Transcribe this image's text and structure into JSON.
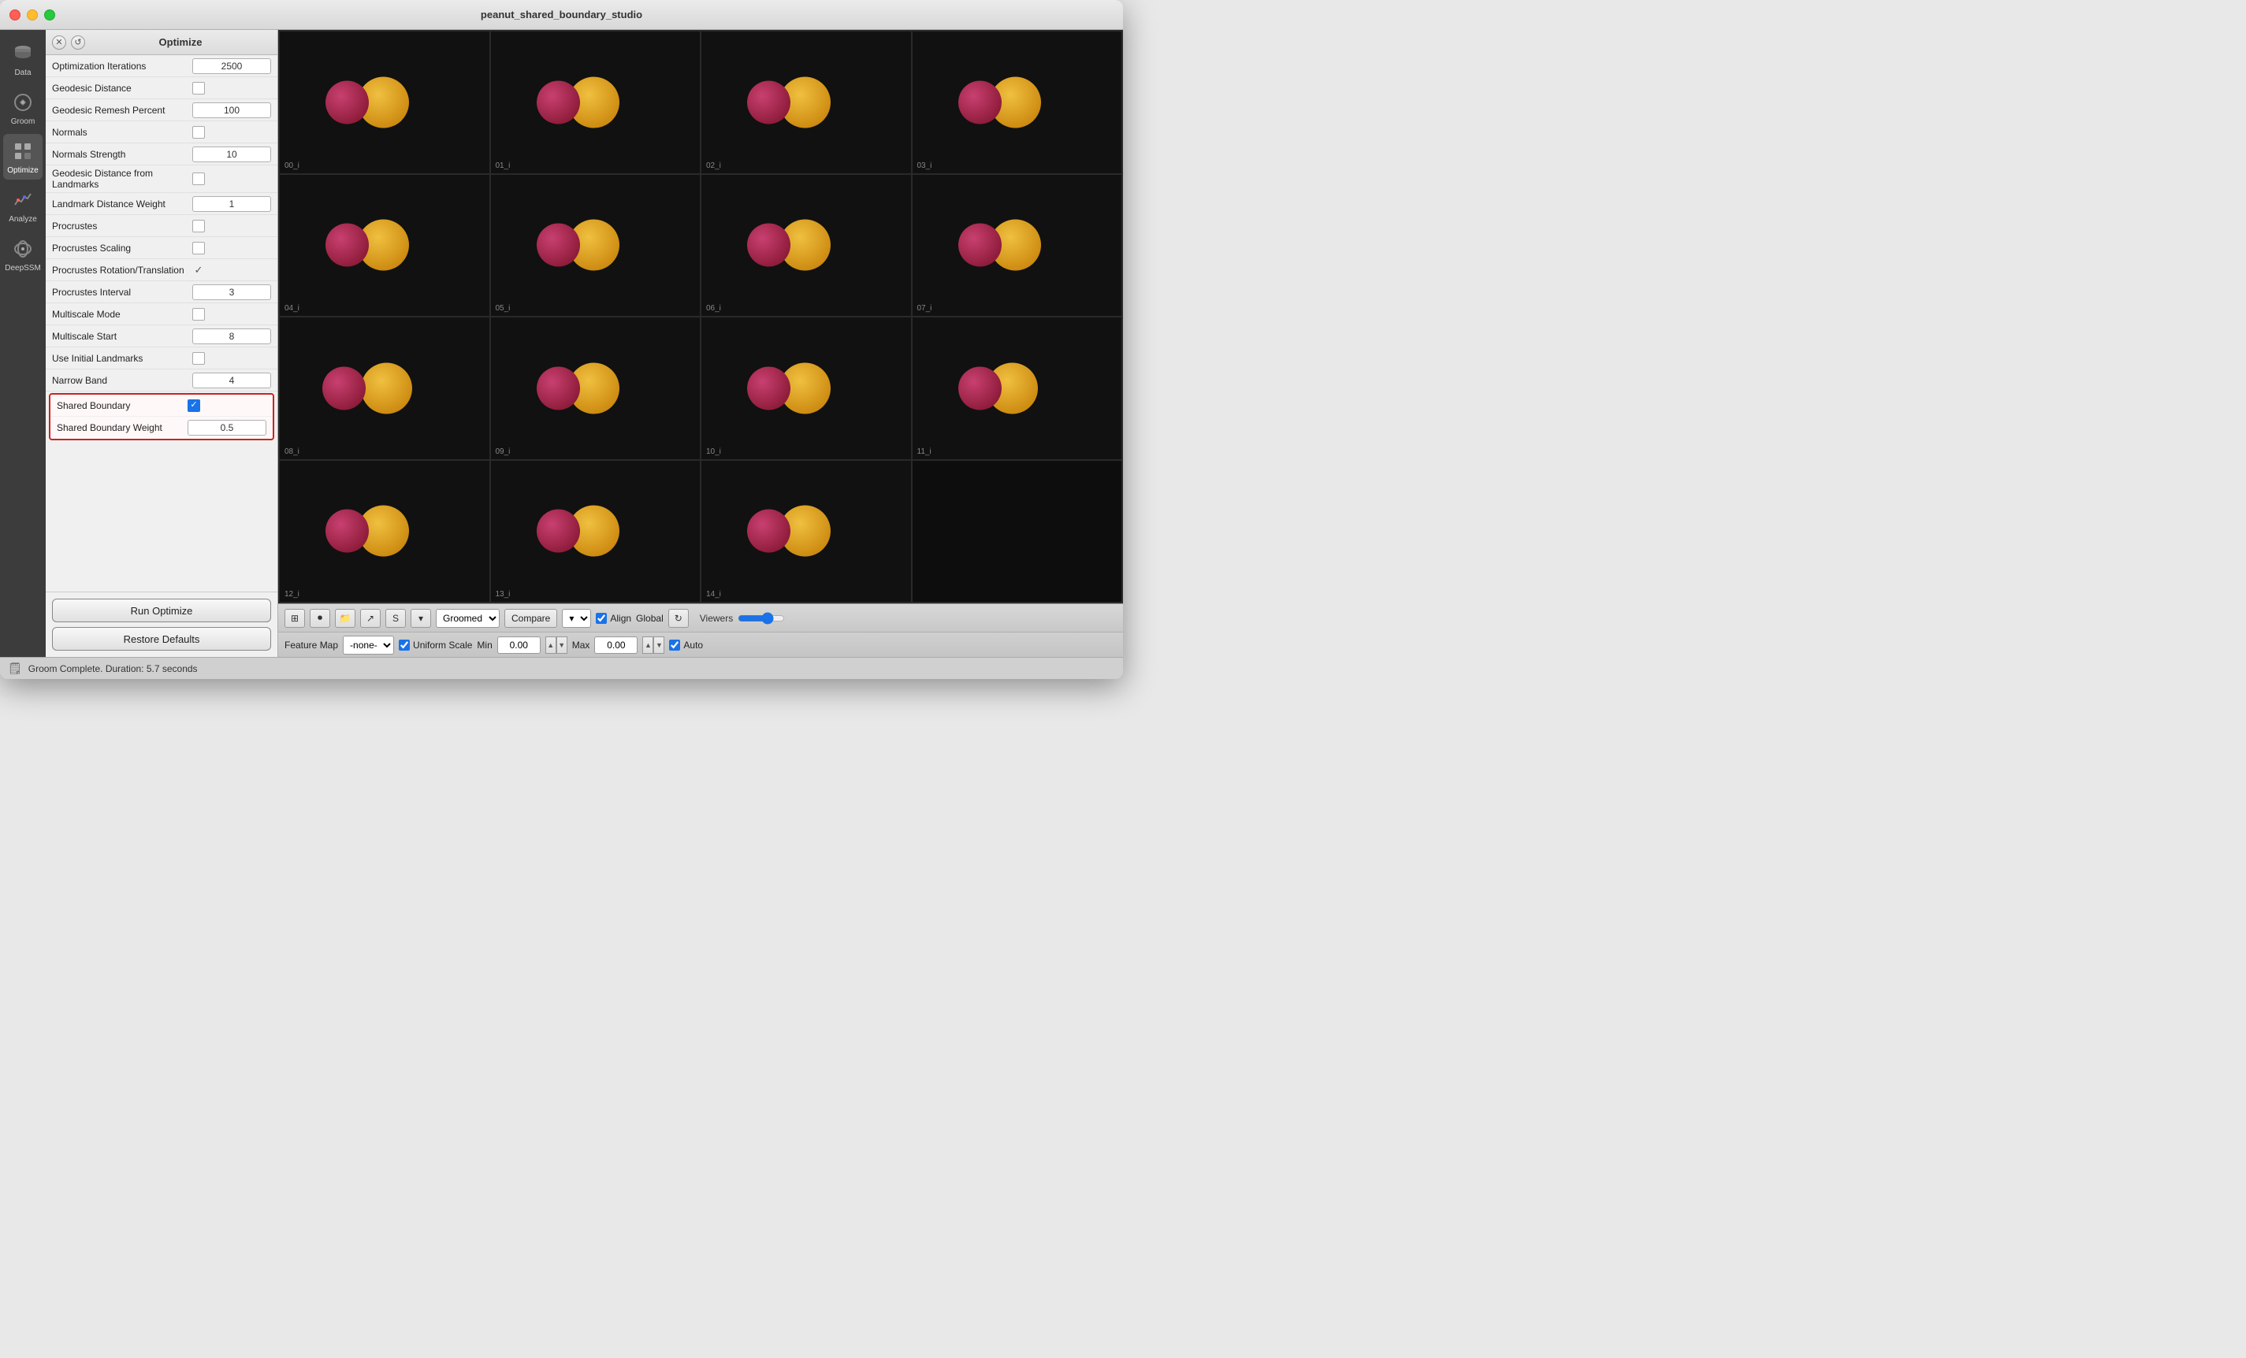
{
  "window": {
    "title": "peanut_shared_boundary_studio",
    "traffic_lights": [
      "red",
      "yellow",
      "green"
    ]
  },
  "sidebar": {
    "items": [
      {
        "id": "data",
        "label": "Data",
        "active": false
      },
      {
        "id": "groom",
        "label": "Groom",
        "active": false
      },
      {
        "id": "optimize",
        "label": "Optimize",
        "active": true
      },
      {
        "id": "analyze",
        "label": "Analyze",
        "active": false
      },
      {
        "id": "deepssm",
        "label": "DeepSSM",
        "active": false
      }
    ]
  },
  "panel": {
    "title": "Optimize",
    "settings": [
      {
        "label": "Optimization Iterations",
        "type": "text",
        "value": "2500"
      },
      {
        "label": "Geodesic Distance",
        "type": "checkbox",
        "checked": false
      },
      {
        "label": "Geodesic Remesh Percent",
        "type": "text",
        "value": "100"
      },
      {
        "label": "Normals",
        "type": "checkbox",
        "checked": false
      },
      {
        "label": "Normals Strength",
        "type": "text",
        "value": "10"
      },
      {
        "label": "Geodesic Distance from Landmarks",
        "type": "checkbox",
        "checked": false
      },
      {
        "label": "Landmark Distance Weight",
        "type": "text",
        "value": "1"
      },
      {
        "label": "Procrustes",
        "type": "checkbox",
        "checked": false
      },
      {
        "label": "Procrustes Scaling",
        "type": "checkbox",
        "checked": false
      },
      {
        "label": "Procrustes Rotation/Translation",
        "type": "checkmark",
        "checked": true
      },
      {
        "label": "Procrustes Interval",
        "type": "text",
        "value": "3"
      },
      {
        "label": "Multiscale Mode",
        "type": "checkbox",
        "checked": false
      },
      {
        "label": "Multiscale Start",
        "type": "text",
        "value": "8"
      },
      {
        "label": "Use Initial Landmarks",
        "type": "checkbox",
        "checked": false
      },
      {
        "label": "Narrow Band",
        "type": "text",
        "value": "4"
      }
    ],
    "highlighted": [
      {
        "label": "Shared Boundary",
        "type": "checkbox",
        "checked": true
      },
      {
        "label": "Shared Boundary Weight",
        "type": "text",
        "value": "0.5"
      }
    ],
    "run_button": "Run Optimize",
    "restore_button": "Restore Defaults"
  },
  "viewport": {
    "cells": [
      {
        "id": "00_i"
      },
      {
        "id": "01_i"
      },
      {
        "id": "02_i"
      },
      {
        "id": "03_i"
      },
      {
        "id": "04_i"
      },
      {
        "id": "05_i"
      },
      {
        "id": "06_i"
      },
      {
        "id": "07_i"
      },
      {
        "id": "08_i"
      },
      {
        "id": "09_i"
      },
      {
        "id": "10_i"
      },
      {
        "id": "11_i"
      },
      {
        "id": "12_i"
      },
      {
        "id": "13_i"
      },
      {
        "id": "14_i"
      },
      {
        "id": "empty"
      }
    ]
  },
  "toolbar1": {
    "icons": [
      "grid",
      "rec",
      "folder",
      "share",
      "s"
    ],
    "groomed_label": "Groomed",
    "compare_label": "Compare",
    "align_label": "Align",
    "global_label": "Global",
    "viewers_label": "Viewers",
    "slider_value": 14
  },
  "toolbar2": {
    "feature_map_label": "Feature Map",
    "none_label": "-none-",
    "uniform_scale_label": "Uniform Scale",
    "min_label": "Min",
    "min_value": "0.00",
    "max_label": "Max",
    "max_value": "0.00",
    "auto_label": "Auto"
  },
  "statusbar": {
    "text": "Groom Complete.  Duration: 5.7 seconds"
  }
}
